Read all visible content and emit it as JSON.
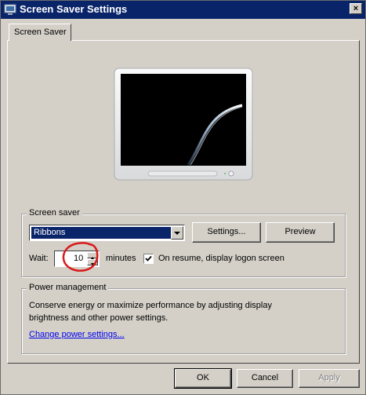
{
  "window": {
    "title": "Screen Saver Settings",
    "close_glyph": "×"
  },
  "tabs": [
    {
      "label": "Screen Saver",
      "selected": true
    }
  ],
  "screen_saver": {
    "group_label": "Screen saver",
    "selected": "Ribbons",
    "settings_label": "Settings...",
    "preview_label": "Preview",
    "wait_label": "Wait:",
    "wait_value": "10",
    "minutes_label": "minutes",
    "on_resume_checked": true,
    "on_resume_label": "On resume, display logon screen"
  },
  "power_management": {
    "group_label": "Power management",
    "description": "Conserve energy or maximize performance by adjusting display brightness and other power settings.",
    "link_label": "Change power settings..."
  },
  "buttons": {
    "ok": "OK",
    "cancel": "Cancel",
    "apply": "Apply"
  },
  "icons": {
    "window": "monitor-icon",
    "dropdown": "chevron-down-icon",
    "checkbox": "check-icon"
  },
  "colors": {
    "titlebar": "#0a246a",
    "selection": "#0a246a",
    "annotation": "#d81b1b",
    "link": "#0000ee"
  }
}
